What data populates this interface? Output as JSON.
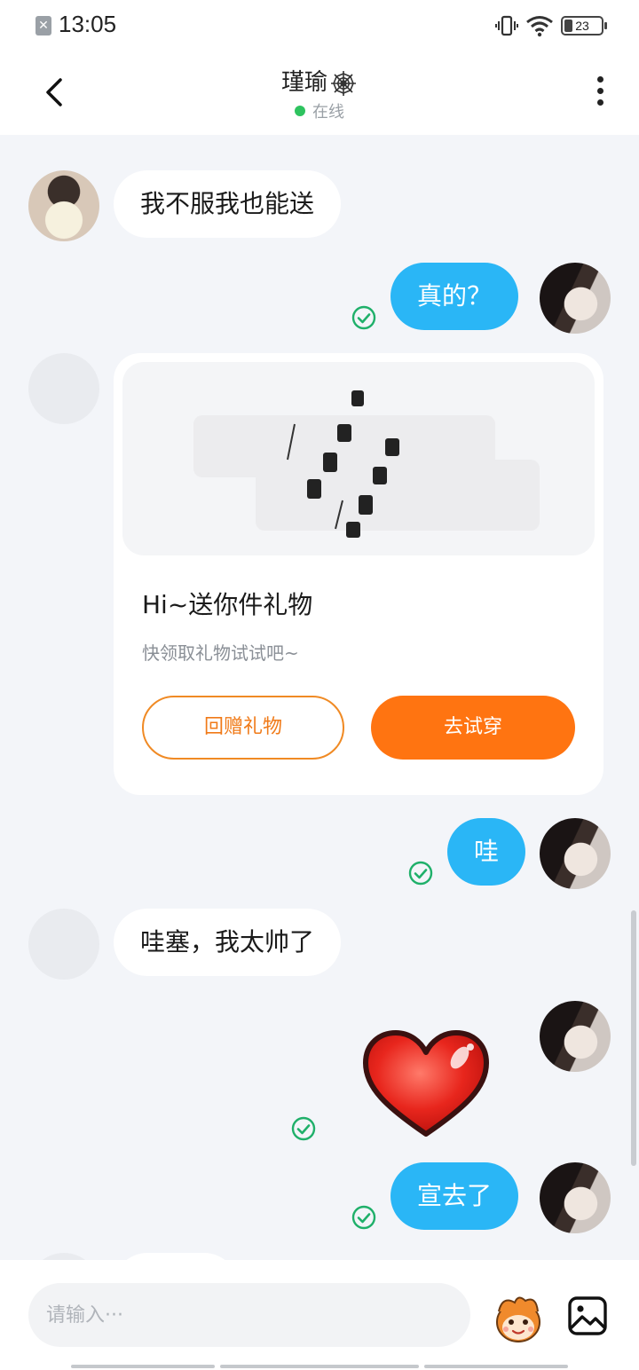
{
  "status_bar": {
    "time": "13:05",
    "battery": "23",
    "battery_level": 0.23
  },
  "header": {
    "contact_name": "瑾瑜",
    "status": "在线"
  },
  "messages": [
    {
      "side": "left",
      "text": "我不服我也能送"
    },
    {
      "side": "right",
      "text": "真的？"
    },
    {
      "side": "left",
      "type": "gift_card",
      "title": "Hi~送你件礼物",
      "subtitle": "快领取礼物试试吧~",
      "return_gift_label": "回赠礼物",
      "try_on_label": "去试穿"
    },
    {
      "side": "right",
      "text": "哇"
    },
    {
      "side": "left",
      "text": "哇塞，我太帅了"
    },
    {
      "side": "right",
      "type": "sticker",
      "sticker": "heart-icon"
    },
    {
      "side": "right",
      "text": "宣去了"
    }
  ],
  "input": {
    "placeholder": "请输入···"
  },
  "icons": [
    "close-notification-icon",
    "vibrate-icon",
    "wifi-icon",
    "battery-icon",
    "back-arrow-icon",
    "spider-web-icon",
    "more-vertical-icon",
    "read-check-icon",
    "heart-icon",
    "emoji-icon",
    "image-icon"
  ],
  "colors": {
    "my_bubble": "#2ab6f6",
    "accent_orange": "#ff7411",
    "online_dot": "#2ec35f",
    "read_check": "#1fb06a"
  }
}
